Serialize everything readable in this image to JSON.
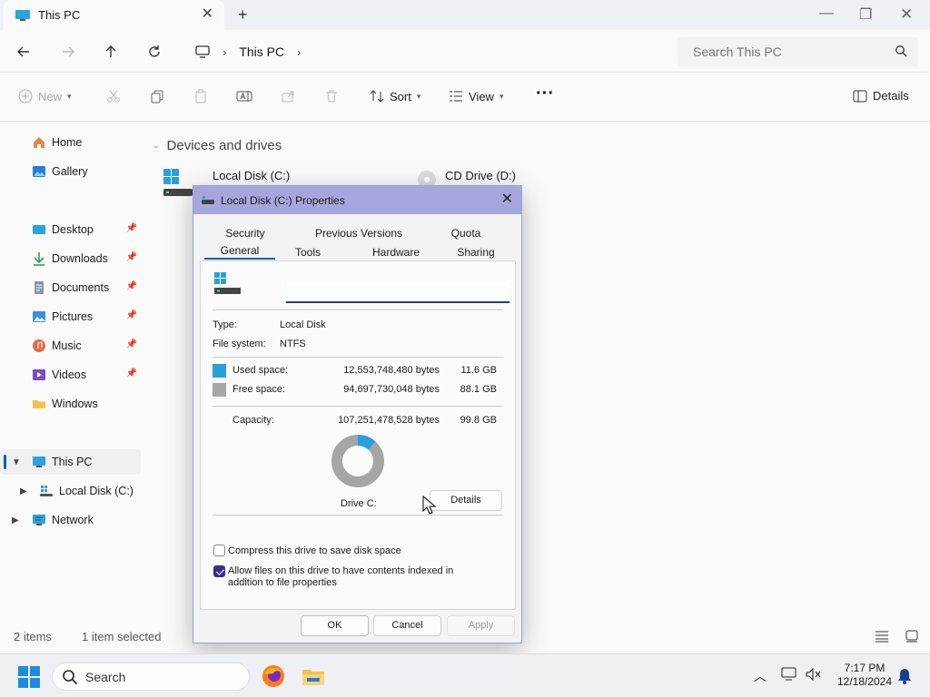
{
  "window": {
    "tab_title": "This PC",
    "breadcrumb": [
      "This PC"
    ],
    "search_placeholder": "Search This PC"
  },
  "toolbar": {
    "new_label": "New",
    "sort_label": "Sort",
    "view_label": "View",
    "more_label": "···",
    "details_label": "Details"
  },
  "sidebar": {
    "items": [
      {
        "label": "Home",
        "icon": "home-icon"
      },
      {
        "label": "Gallery",
        "icon": "gallery-icon"
      },
      {
        "label": "Desktop",
        "icon": "desktop-icon",
        "pinned": true
      },
      {
        "label": "Downloads",
        "icon": "downloads-icon",
        "pinned": true
      },
      {
        "label": "Documents",
        "icon": "documents-icon",
        "pinned": true
      },
      {
        "label": "Pictures",
        "icon": "pictures-icon",
        "pinned": true
      },
      {
        "label": "Music",
        "icon": "music-icon",
        "pinned": true
      },
      {
        "label": "Videos",
        "icon": "videos-icon",
        "pinned": true
      },
      {
        "label": "Windows",
        "icon": "folder-icon"
      },
      {
        "label": "This PC",
        "icon": "this-pc-icon",
        "selected": true
      },
      {
        "label": "Local Disk (C:)",
        "icon": "local-disk-icon"
      },
      {
        "label": "Network",
        "icon": "network-icon"
      }
    ]
  },
  "content": {
    "group_title": "Devices and drives",
    "drives": [
      {
        "name": "Local Disk (C:)"
      },
      {
        "name": "CD Drive (D:)"
      }
    ]
  },
  "status": {
    "items_count": "2 items",
    "selection": "1 item selected"
  },
  "dialog": {
    "title": "Local Disk (C:) Properties",
    "tabs_row1": [
      "Security",
      "Previous Versions",
      "Quota"
    ],
    "tabs_row2": [
      "General",
      "Tools",
      "Hardware",
      "Sharing"
    ],
    "selected_tab": "General",
    "name_value": "",
    "type_label": "Type:",
    "type_value": "Local Disk",
    "fs_label": "File system:",
    "fs_value": "NTFS",
    "used": {
      "label": "Used space:",
      "bytes": "12,553,748,480 bytes",
      "size": "11.6 GB",
      "color": "#2b9fd9"
    },
    "free": {
      "label": "Free space:",
      "bytes": "94,697,730,048 bytes",
      "size": "88.1 GB",
      "color": "#a6a6a6"
    },
    "capacity": {
      "label": "Capacity:",
      "bytes": "107,251,478,528 bytes",
      "size": "99.8 GB"
    },
    "used_fraction": 0.117,
    "drive_label": "Drive C:",
    "details_button": "Details",
    "compress_label": "Compress this drive to save disk space",
    "compress_checked": false,
    "index_label_1": "Allow files on this drive to have contents indexed in",
    "index_label_2": "addition to file properties",
    "index_checked": true,
    "ok": "OK",
    "cancel": "Cancel",
    "apply": "Apply"
  },
  "taskbar": {
    "search_label": "Search",
    "time": "7:17 PM",
    "date": "12/18/2024"
  }
}
